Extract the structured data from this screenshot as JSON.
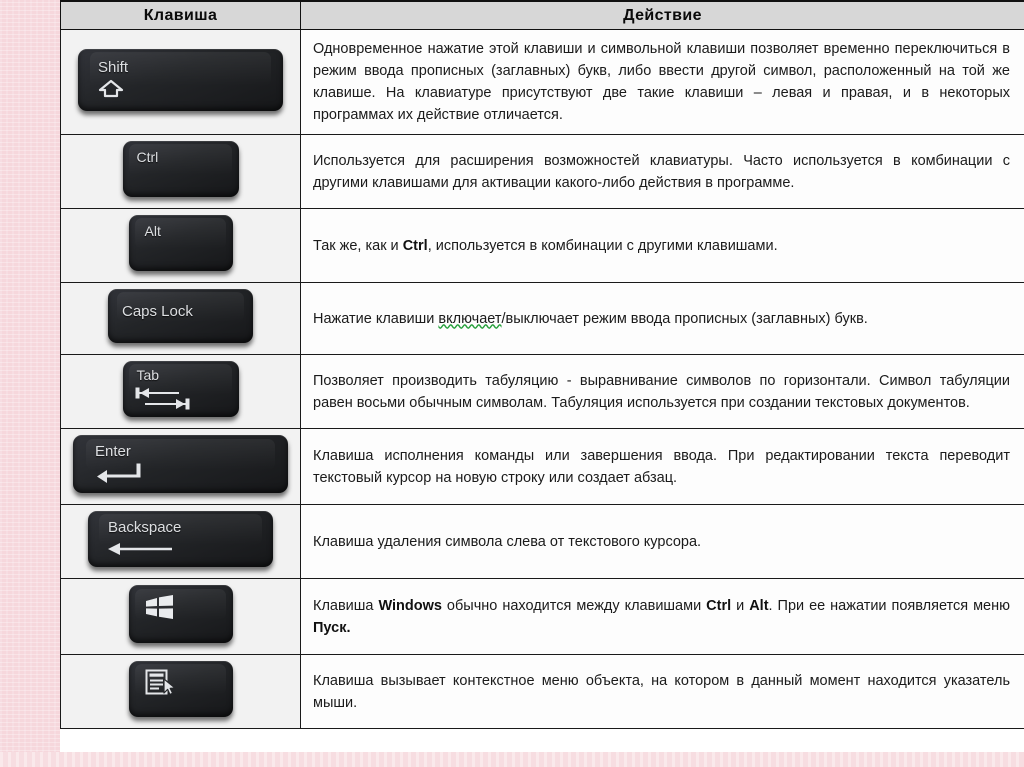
{
  "table": {
    "headers": {
      "key_column": "Клавиша",
      "action_column": "Действие"
    },
    "rows": [
      {
        "key_name": "Shift",
        "key_label": "Shift",
        "key_icon": "shift-up-arrow-icon",
        "description_html": "Одновременное нажатие этой клавиши и символьной клавиши позволяет временно переключиться в режим ввода прописных (заглавных) букв, либо ввести другой символ, расположенный на той же клавише. На клавиатуре присутствуют две такие клавиши &ndash; левая и правая, и в некоторых программах их действие отличается."
      },
      {
        "key_name": "Ctrl",
        "key_label": "Ctrl",
        "key_icon": "",
        "description_html": "Используется для расширения возможностей клавиатуры. Часто используется в комбинации с другими клавишами для активации какого-либо действия в программе."
      },
      {
        "key_name": "Alt",
        "key_label": "Alt",
        "key_icon": "",
        "description_html": "Так же, как и <b>Ctrl</b>, используется в комбинации с другими клавишами."
      },
      {
        "key_name": "Caps Lock",
        "key_label": "Caps Lock",
        "key_icon": "",
        "description_html": "Нажатие клавиши <span class=\"spell\">включает</span>/выключает режим ввода прописных (заглавных) букв."
      },
      {
        "key_name": "Tab",
        "key_label": "Tab",
        "key_icon": "tab-double-arrow-icon",
        "description_html": "Позволяет производить табуляцию - выравнивание символов по горизонтали. Символ табуляции равен восьми обычным символам. Табуляция используется при создании текстовых документов."
      },
      {
        "key_name": "Enter",
        "key_label": "Enter",
        "key_icon": "enter-return-arrow-icon",
        "description_html": "Клавиша исполнения команды или завершения ввода. При редактировании текста переводит текстовый курсор на новую строку или создает абзац."
      },
      {
        "key_name": "Backspace",
        "key_label": "Backspace",
        "key_icon": "backspace-left-arrow-icon",
        "description_html": "Клавиша удаления символа слева от текстового курсора."
      },
      {
        "key_name": "Windows",
        "key_label": "",
        "key_icon": "windows-logo-icon",
        "description_html": "Клавиша <b>Windows</b> обычно находится между клавишами <b>Ctrl</b> и <b>Alt</b>. При ее нажатии появляется меню <b>Пуск.</b>"
      },
      {
        "key_name": "Menu",
        "key_label": "",
        "key_icon": "context-menu-icon",
        "description_html": "Клавиша вызывает контекстное меню объекта, на котором в данный момент находится указатель мыши."
      }
    ]
  },
  "colors": {
    "page_background": "#f6d7dc",
    "slide_background": "#ffffff",
    "header_fill": "#d7d7d7",
    "key_cell_fill": "#f2f2f2",
    "keycap_dark": "#232528",
    "keycap_text": "#dcdee1",
    "border": "#1a1a1a",
    "spellcheck_underline": "#27a03c"
  }
}
